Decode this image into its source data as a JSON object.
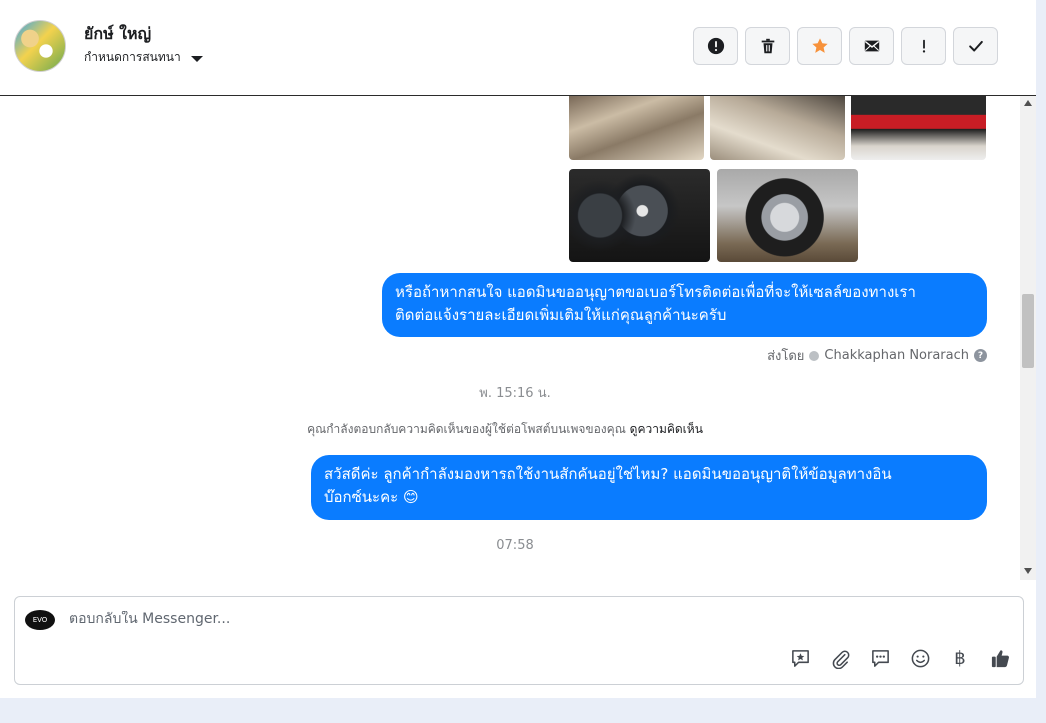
{
  "header": {
    "contact_name": "ยักษ์ ใหญ่",
    "assign_label": "กำหนดการสนทนา",
    "actions": [
      {
        "name": "mark-spam",
        "icon": "exclamation-circle-icon"
      },
      {
        "name": "delete",
        "icon": "trash-icon"
      },
      {
        "name": "star",
        "icon": "star-icon",
        "color": "#f7923b"
      },
      {
        "name": "mark-unread",
        "icon": "envelope-icon"
      },
      {
        "name": "follow-up",
        "icon": "exclamation-icon"
      },
      {
        "name": "done",
        "icon": "check-icon"
      }
    ]
  },
  "messages": [
    {
      "type": "outgoing",
      "lines": [
        "หรือถ้าหากสนใจ แอดมินขออนุญาตขอเบอร์โทรติดต่อเพื่อที่จะให้เซลล์ของทางเรา",
        "ติดต่อแจ้งรายละเอียดเพิ่มเติมให้แก่คุณลูกค้านะครับ"
      ]
    },
    {
      "type": "outgoing",
      "lines": [
        "สวัสดีค่ะ ลูกค้ากำลังมองหารถใช้งานสักคันอยู่ใช่ไหม? แอดมินขออนุญาติให้ข้อมูลทางอิน",
        "บ๊อกซ์นะคะ 😊"
      ]
    }
  ],
  "sent_by": {
    "prefix": "ส่งโดย",
    "name": "Chakkaphan Norarach",
    "help": "?"
  },
  "timestamps": [
    "พ. 15:16 น.",
    "07:58"
  ],
  "reply_note": {
    "text": "คุณกำลังตอบกลับความคิดเห็นของผู้ใช้ต่อโพสต์บนเพจของคุณ",
    "link": "ดูความคิดเห็น"
  },
  "composer": {
    "page_logo_text": "EVO",
    "placeholder": "ตอบกลับใน Messenger...",
    "baht_symbol": "฿",
    "tools": [
      "saved-reply-icon",
      "attach-icon",
      "comment-icon",
      "emoji-icon",
      "payment-icon",
      "like-icon"
    ]
  },
  "colors": {
    "bubble": "#0a7cff",
    "accent_star": "#f7923b"
  }
}
